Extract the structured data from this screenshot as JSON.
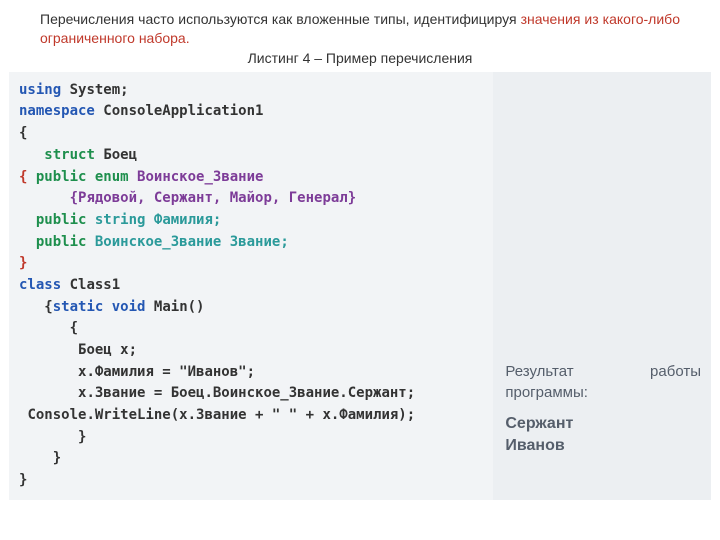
{
  "intro": {
    "plain": "Перечисления часто используются как вложенные типы, идентифицируя ",
    "highlight": "значения из какого-либо ограниченного набора.",
    "caption": "Листинг 4 – Пример перечисления"
  },
  "code": {
    "using_kw": "using",
    "using_ns": "System;",
    "namespace_kw": "namespace",
    "namespace_name": "ConsoleApplication1",
    "open_brace": "{",
    "struct_kw": "struct",
    "struct_name": "Боец",
    "line_open2": "{ ",
    "public_kw": "public",
    "enum_kw": "enum",
    "enum_name": "Воинское_Звание",
    "enum_open": "{",
    "enum_members": "Рядовой, Сержант, Майор, Генерал",
    "enum_close": "}",
    "string_kw": "string",
    "field1": "Фамилия;",
    "field2_type": "Воинское_Звание",
    "field2_name": "Звание;",
    "close_brace": "}",
    "class_kw": "class",
    "class_name": "Class1",
    "open_brace3": "{",
    "static_kw": "static",
    "void_kw": "void",
    "main_sig": "Main()",
    "open_brace4": "{",
    "body1": "Боец х;",
    "body2": "х.Фамилия = \"Иванов\";",
    "body3": "х.Звание = Боец.Воинское_Звание.Сержант;",
    "body4": "Console.WriteLine(x.Звание + \" \" + x.Фамилия);",
    "close_brace4": "}",
    "close_brace3": "}",
    "close_brace1": "}"
  },
  "output": {
    "label_a": "Результат",
    "label_b": "работы",
    "label_c": "программы:",
    "result": "Сержант\nИванов"
  }
}
